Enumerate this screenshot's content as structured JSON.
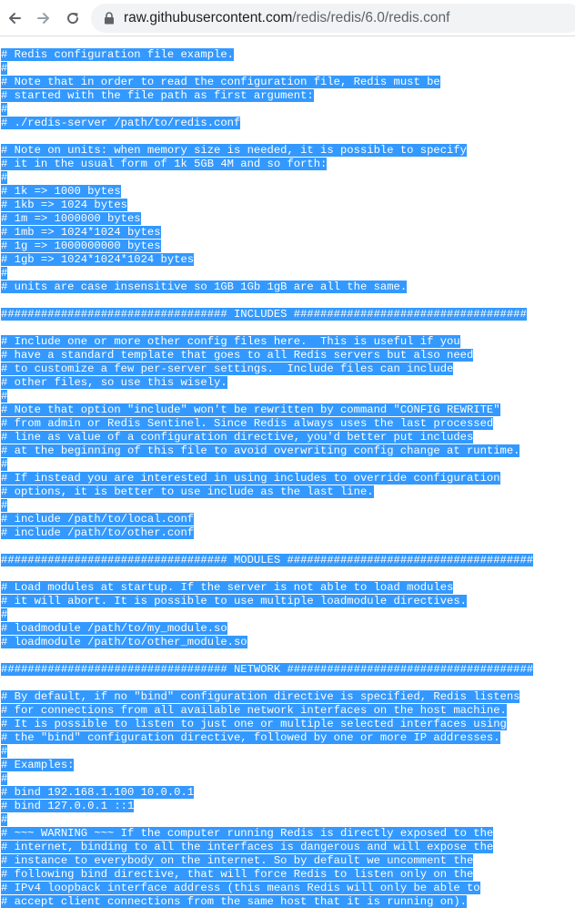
{
  "browser": {
    "url_host": "raw.githubusercontent.com",
    "url_path": "/redis/redis/6.0/redis.conf",
    "icons": {
      "back": "arrow-left-icon",
      "forward": "arrow-right-icon",
      "reload": "reload-icon",
      "secure": "lock-icon"
    }
  },
  "colors": {
    "selection": "#3399ff",
    "selection_text": "#ffffff"
  },
  "file_lines": [
    "# Redis configuration file example.",
    "#",
    "# Note that in order to read the configuration file, Redis must be",
    "# started with the file path as first argument:",
    "#",
    "# ./redis-server /path/to/redis.conf",
    "",
    "# Note on units: when memory size is needed, it is possible to specify",
    "# it in the usual form of 1k 5GB 4M and so forth:",
    "#",
    "# 1k => 1000 bytes",
    "# 1kb => 1024 bytes",
    "# 1m => 1000000 bytes",
    "# 1mb => 1024*1024 bytes",
    "# 1g => 1000000000 bytes",
    "# 1gb => 1024*1024*1024 bytes",
    "#",
    "# units are case insensitive so 1GB 1Gb 1gB are all the same.",
    "",
    "################################## INCLUDES ###################################",
    "",
    "# Include one or more other config files here.  This is useful if you",
    "# have a standard template that goes to all Redis servers but also need",
    "# to customize a few per-server settings.  Include files can include",
    "# other files, so use this wisely.",
    "#",
    "# Note that option \"include\" won't be rewritten by command \"CONFIG REWRITE\"",
    "# from admin or Redis Sentinel. Since Redis always uses the last processed",
    "# line as value of a configuration directive, you'd better put includes",
    "# at the beginning of this file to avoid overwriting config change at runtime.",
    "#",
    "# If instead you are interested in using includes to override configuration",
    "# options, it is better to use include as the last line.",
    "#",
    "# include /path/to/local.conf",
    "# include /path/to/other.conf",
    "",
    "################################## MODULES #####################################",
    "",
    "# Load modules at startup. If the server is not able to load modules",
    "# it will abort. It is possible to use multiple loadmodule directives.",
    "#",
    "# loadmodule /path/to/my_module.so",
    "# loadmodule /path/to/other_module.so",
    "",
    "################################## NETWORK #####################################",
    "",
    "# By default, if no \"bind\" configuration directive is specified, Redis listens",
    "# for connections from all available network interfaces on the host machine.",
    "# It is possible to listen to just one or multiple selected interfaces using",
    "# the \"bind\" configuration directive, followed by one or more IP addresses.",
    "#",
    "# Examples:",
    "#",
    "# bind 192.168.1.100 10.0.0.1",
    "# bind 127.0.0.1 ::1",
    "#",
    "# ~~~ WARNING ~~~ If the computer running Redis is directly exposed to the",
    "# internet, binding to all the interfaces is dangerous and will expose the",
    "# instance to everybody on the internet. So by default we uncomment the",
    "# following bind directive, that will force Redis to listen only on the",
    "# IPv4 loopback interface address (this means Redis will only be able to",
    "# accept client connections from the same host that it is running on)."
  ]
}
